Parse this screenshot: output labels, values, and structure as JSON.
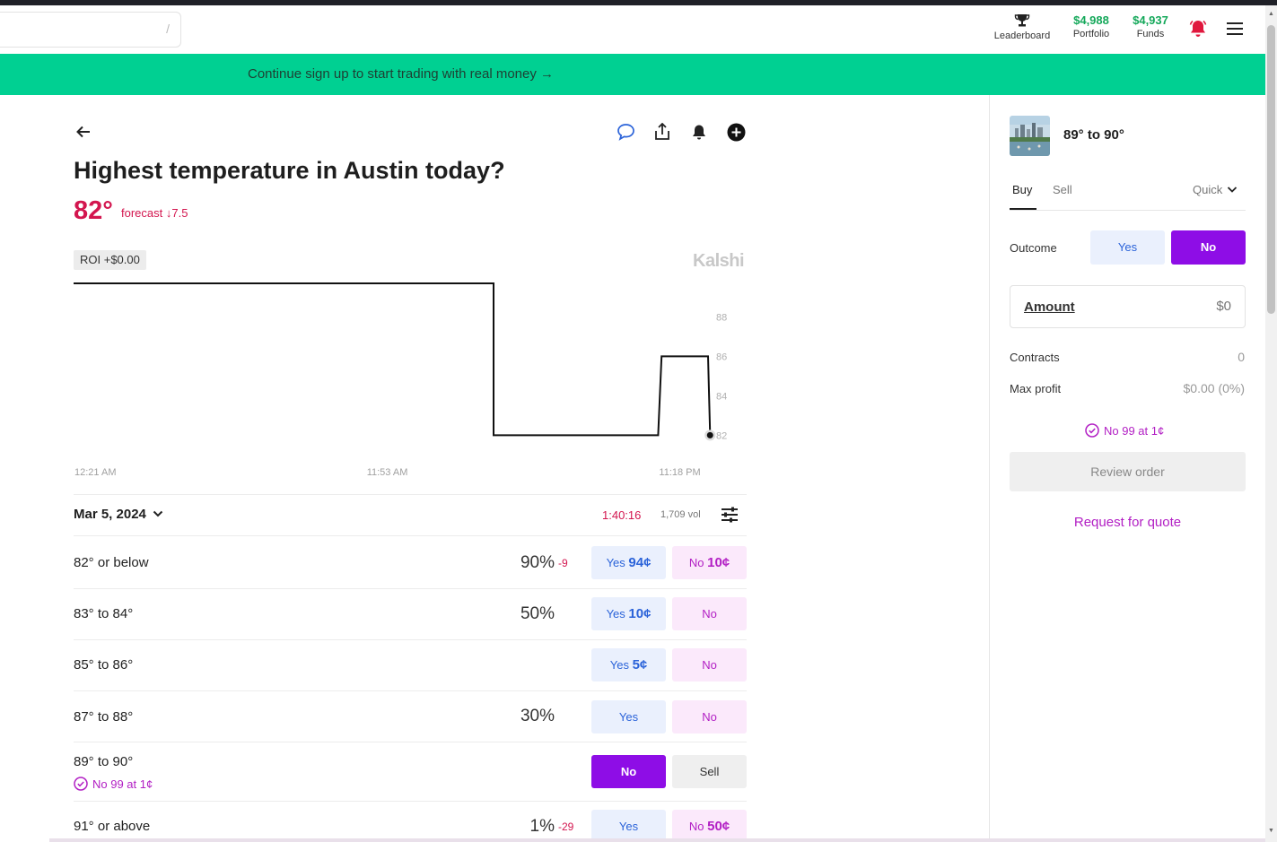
{
  "header": {
    "search_hint": "/",
    "leaderboard_label": "Leaderboard",
    "portfolio_value": "$4,988",
    "portfolio_label": "Portfolio",
    "funds_value": "$4,937",
    "funds_label": "Funds"
  },
  "banner": {
    "text": "Continue sign up to start trading with real money →"
  },
  "market": {
    "title": "Highest temperature in Austin today?",
    "current": "82°",
    "forecast": "forecast ↓7.5",
    "roi": "ROI +$0.00",
    "brand": "Kalshi"
  },
  "chart_data": {
    "type": "line",
    "step": true,
    "x_ticks": [
      "12:21 AM",
      "11:53 AM",
      "11:18 PM"
    ],
    "y_ticks": [
      82,
      84,
      86,
      88
    ],
    "ylim": [
      81.2,
      89.7
    ],
    "x_domain": [
      0,
      1
    ],
    "points": [
      {
        "x": 0.0,
        "y": 89.7
      },
      {
        "x": 0.615,
        "y": 89.7
      },
      {
        "x": 0.615,
        "y": 82
      },
      {
        "x": 0.856,
        "y": 82
      },
      {
        "x": 0.861,
        "y": 86
      },
      {
        "x": 0.929,
        "y": 86
      },
      {
        "x": 0.932,
        "y": 82
      }
    ],
    "last_point": {
      "x": 0.932,
      "y": 82
    },
    "grid": false,
    "line_color": "#111111"
  },
  "filters": {
    "date": "Mar 5, 2024",
    "timer": "1:40:16",
    "volume": "1,709 vol"
  },
  "outcomes": [
    {
      "label": "82° or below",
      "pct": "90%",
      "chg": "-9",
      "yes_prefix": "Yes",
      "yes_price": "94¢",
      "no_prefix": "No",
      "no_price": "10¢"
    },
    {
      "label": "83° to 84°",
      "pct": "50%",
      "chg": "",
      "yes_prefix": "Yes",
      "yes_price": "10¢",
      "no_prefix": "No",
      "no_price": ""
    },
    {
      "label": "85° to 86°",
      "pct": "",
      "chg": "",
      "yes_prefix": "Yes",
      "yes_price": "5¢",
      "no_prefix": "No",
      "no_price": ""
    },
    {
      "label": "87° to 88°",
      "pct": "30%",
      "chg": "",
      "yes_prefix": "Yes",
      "yes_price": "",
      "no_prefix": "No",
      "no_price": ""
    },
    {
      "label": "89° to 90°",
      "position": "No 99 at 1¢",
      "no_label": "No",
      "sell_label": "Sell"
    },
    {
      "label": "91° or above",
      "pct": "1%",
      "chg": "-29",
      "yes_prefix": "Yes",
      "yes_price": "",
      "no_prefix": "No",
      "no_price": "50¢"
    }
  ],
  "side": {
    "title": "89° to 90°",
    "tab_buy": "Buy",
    "tab_sell": "Sell",
    "mode": "Quick",
    "outcome_label": "Outcome",
    "outcome_yes": "Yes",
    "outcome_no": "No",
    "amount_label": "Amount",
    "amount_placeholder": "$0",
    "contracts_label": "Contracts",
    "contracts_value": "0",
    "max_profit_label": "Max profit",
    "max_profit_value": "$0.00 (0%)",
    "position": "No 99 at 1¢",
    "review_label": "Review order",
    "rfq_label": "Request for quote"
  },
  "colors": {
    "accent_green": "#00d092",
    "money_green": "#14a85a",
    "alert_red": "#d3164f",
    "no_purple": "#8e0de6",
    "yes_blue": "#2b63d9"
  }
}
